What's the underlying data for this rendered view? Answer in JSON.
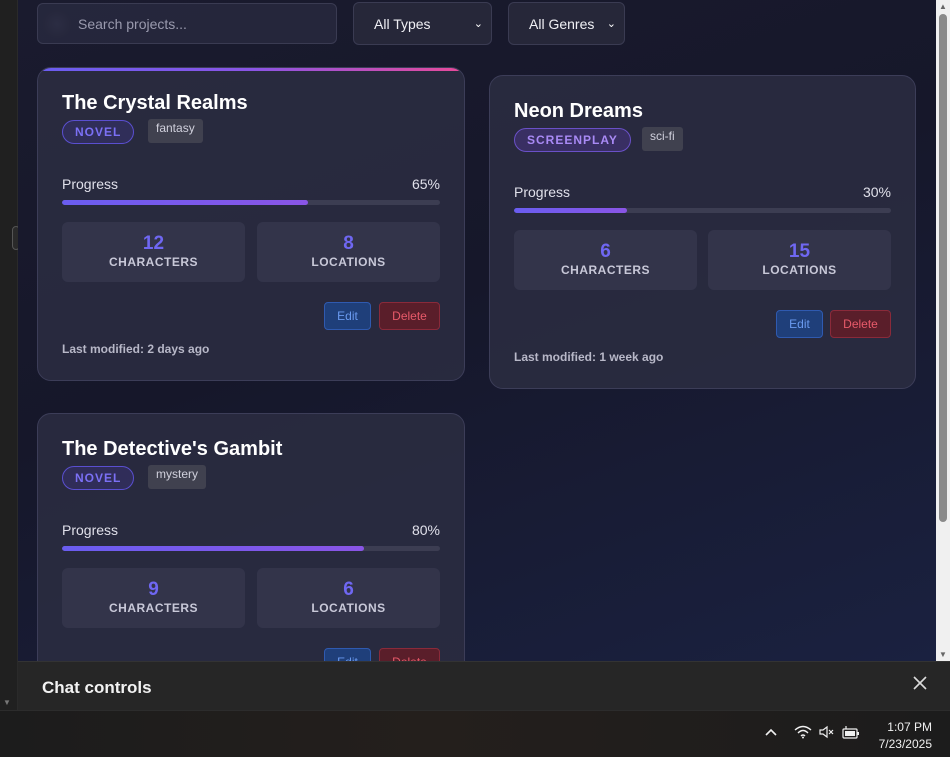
{
  "filters": {
    "search_placeholder": "Search projects...",
    "type_selected": "All Types",
    "genre_selected": "All Genres"
  },
  "cards": [
    {
      "title": "The Crystal Realms",
      "type": "NOVEL",
      "genre": "fantasy",
      "progress_label": "Progress",
      "progress_value": "65%",
      "progress_fraction": 0.65,
      "characters_count": "12",
      "characters_label": "CHARACTERS",
      "locations_count": "8",
      "locations_label": "LOCATIONS",
      "edit_label": "Edit",
      "delete_label": "Delete",
      "last_modified": "Last modified: 2 days ago"
    },
    {
      "title": "Neon Dreams",
      "type": "SCREENPLAY",
      "genre": "sci-fi",
      "progress_label": "Progress",
      "progress_value": "30%",
      "progress_fraction": 0.3,
      "characters_count": "6",
      "characters_label": "CHARACTERS",
      "locations_count": "15",
      "locations_label": "LOCATIONS",
      "edit_label": "Edit",
      "delete_label": "Delete",
      "last_modified": "Last modified: 1 week ago"
    },
    {
      "title": "The Detective's Gambit",
      "type": "NOVEL",
      "genre": "mystery",
      "progress_label": "Progress",
      "progress_value": "80%",
      "progress_fraction": 0.8,
      "characters_count": "9",
      "characters_label": "CHARACTERS",
      "locations_count": "6",
      "locations_label": "LOCATIONS",
      "edit_label": "Edit",
      "delete_label": "Delete"
    }
  ],
  "chat_controls": {
    "title": "Chat controls"
  },
  "taskbar": {
    "time": "1:07 PM",
    "date": "7/23/2025"
  },
  "icons": [
    "search-icon",
    "chevron-down-icon",
    "close-icon",
    "tray-chevron-up-icon",
    "wifi-icon",
    "volume-muted-icon",
    "battery-icon"
  ],
  "colors": {
    "accent": "#6f67f2",
    "edit": "#1f3f7a",
    "delete": "#5a1e2a"
  }
}
